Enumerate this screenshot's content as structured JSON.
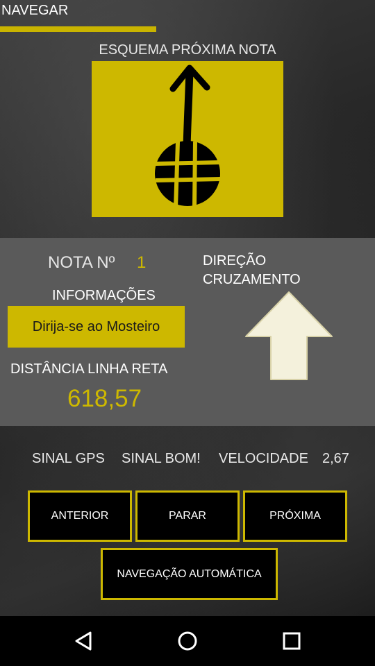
{
  "header": {
    "title": "NAVEGAR"
  },
  "scheme": {
    "label": "ESQUEMA PRÓXIMA NOTA"
  },
  "note": {
    "label": "NOTA Nº",
    "number": "1"
  },
  "info": {
    "label": "INFORMAÇÕES",
    "text": "Dirija-se ao Mosteiro"
  },
  "distance": {
    "label": "DISTÂNCIA LINHA RETA",
    "value": "618,57"
  },
  "direction": {
    "label": "DIREÇÃO CRUZAMENTO"
  },
  "status": {
    "gps_label": "SINAL GPS",
    "gps_value": "SINAL BOM!",
    "speed_label": "VELOCIDADE",
    "speed_value": "2,67"
  },
  "buttons": {
    "previous": "ANTERIOR",
    "stop": "PARAR",
    "next": "PRÓXIMA",
    "auto": "NAVEGAÇÃO AUTOMÁTICA"
  },
  "nav_icons": [
    "back-icon",
    "home-icon",
    "recents-icon"
  ],
  "colors": {
    "accent": "#cdb800",
    "panel": "#5a5a5a",
    "button_bg": "#000000"
  }
}
